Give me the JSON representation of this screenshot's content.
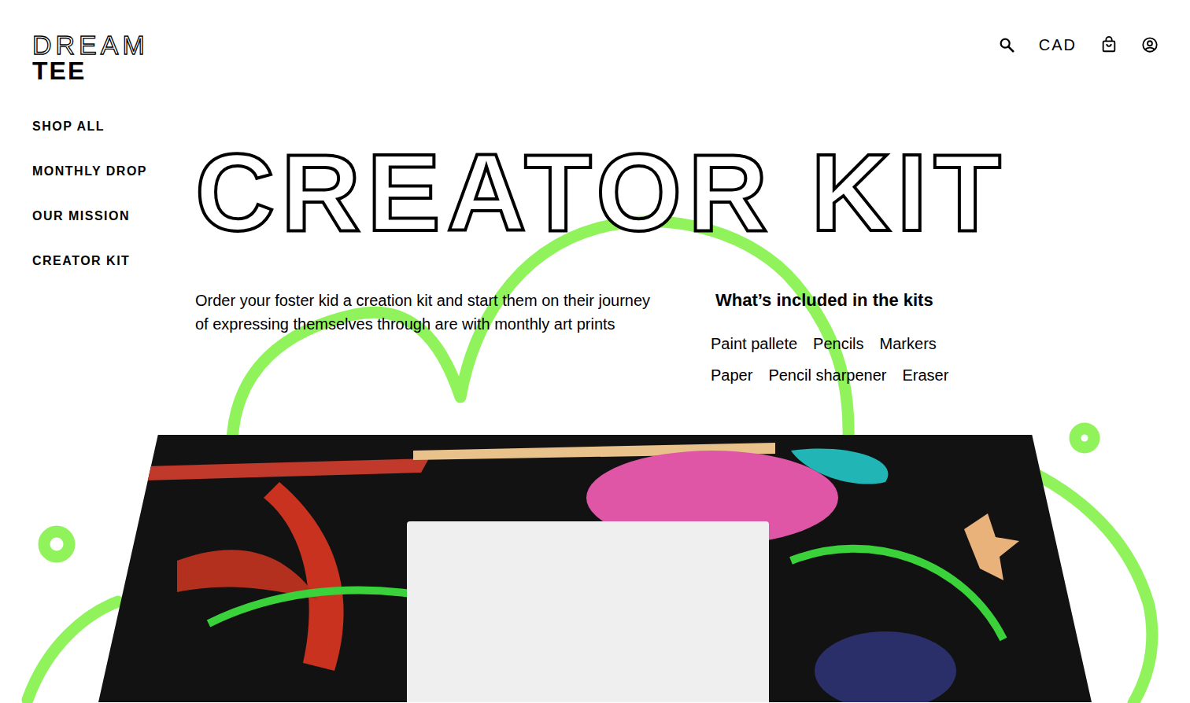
{
  "logo": {
    "outline": "DREAM",
    "solid": "TEE"
  },
  "header": {
    "currency": "CAD"
  },
  "nav": [
    {
      "label": "SHOP ALL"
    },
    {
      "label": "MONTHLY DROP"
    },
    {
      "label": "OUR MISSION"
    },
    {
      "label": "CREATOR KIT"
    }
  ],
  "page": {
    "title": "CREATOR KIT",
    "description": "Order your foster kid a creation kit and start them on their journey of expressing themselves through are with monthly art prints",
    "included_heading": "What’s included in the kits",
    "included": [
      "Paint pallete",
      "Pencils",
      "Markers",
      "Paper",
      "Pencil sharpener",
      "Eraser"
    ]
  }
}
